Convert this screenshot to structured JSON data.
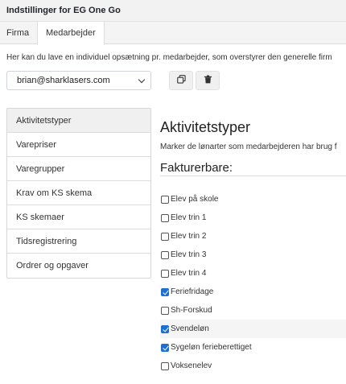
{
  "window": {
    "title": "Indstillinger for EG One Go"
  },
  "tabs": [
    {
      "label": "Firma",
      "active": false
    },
    {
      "label": "Medarbejder",
      "active": true
    }
  ],
  "description": "Her kan du lave en individuel opsætning pr. medarbejder, som overstyrer den generelle firm",
  "employee_select": {
    "value": "brian@sharklasers.com"
  },
  "actions": {
    "copy_icon": "copy-icon",
    "delete_icon": "trash-icon"
  },
  "sidebar": {
    "items": [
      {
        "label": "Aktivitetstyper",
        "active": true
      },
      {
        "label": "Varepriser",
        "active": false
      },
      {
        "label": "Varegrupper",
        "active": false
      },
      {
        "label": "Krav om KS skema",
        "active": false
      },
      {
        "label": "KS skemaer",
        "active": false
      },
      {
        "label": "Tidsregistrering",
        "active": false
      },
      {
        "label": "Ordrer og opgaver",
        "active": false
      }
    ]
  },
  "main": {
    "title": "Aktivitetstyper",
    "subtitle": "Marker de lønarter som medarbejderen har brug f",
    "section": "Fakturerbare:",
    "checkboxes": [
      {
        "label": "Elev på skole",
        "checked": false
      },
      {
        "label": "Elev trin 1",
        "checked": false
      },
      {
        "label": "Elev trin 2",
        "checked": false
      },
      {
        "label": "Elev trin 3",
        "checked": false
      },
      {
        "label": "Elev trin 4",
        "checked": false
      },
      {
        "label": "Feriefridage",
        "checked": true
      },
      {
        "label": "Sh-Forskud",
        "checked": false
      },
      {
        "label": "Svendeløn",
        "checked": true
      },
      {
        "label": "Sygeløn ferieberettiget",
        "checked": true
      },
      {
        "label": "Voksenelev",
        "checked": false
      }
    ]
  },
  "colors": {
    "accent": "#1f6fd1",
    "active_nav_bg": "#f0f0f0"
  }
}
